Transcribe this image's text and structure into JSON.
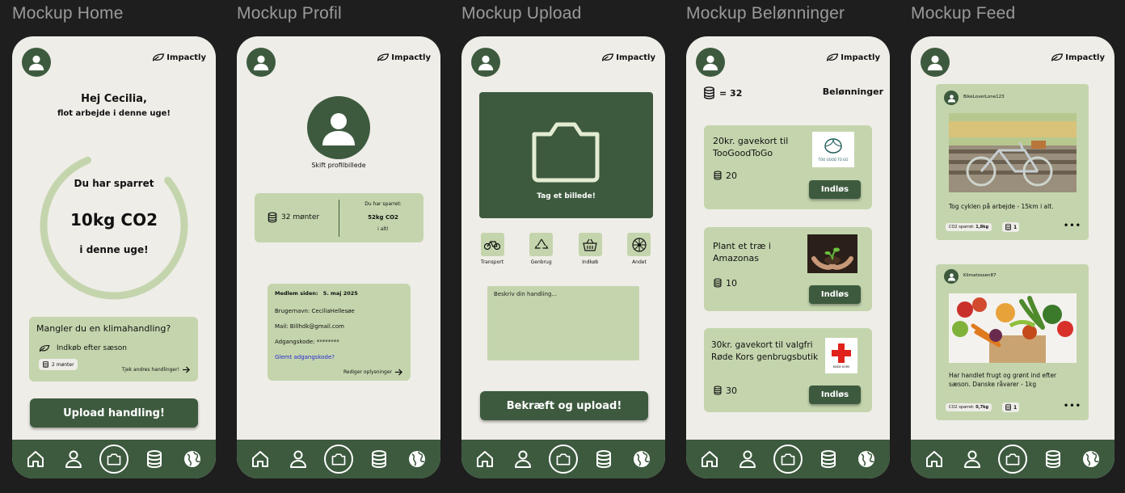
{
  "labels": {
    "home": "Mockup Home",
    "profil": "Mockup Profil",
    "upload": "Mockup Upload",
    "rewards": "Mockup Belønninger",
    "feed": "Mockup Feed"
  },
  "brand": {
    "name": "Impactly",
    "primary": "#3d5a3e",
    "card": "#c4d5ad",
    "bg": "#efede8"
  },
  "home": {
    "greeting": "Hej Cecilia,",
    "subgreeting": "flot arbejde  i denne uge!",
    "saved_label": "Du har sparret",
    "saved_value": "10kg CO2",
    "saved_period": "i denne uge!",
    "progress": 0.8,
    "missing_title": "Mangler du en klimahandling?",
    "suggestion": "Indkøb efter sæson",
    "coins": "2 mønter",
    "more_link": "Tjek andres handlinger!",
    "upload_button": "Upload handling!"
  },
  "profil": {
    "change_photo": "Skift profilbillede",
    "coins": "32 mønter",
    "saved_label": "Du har sparret:",
    "saved_value": "52kg CO2",
    "saved_total": "i alt!",
    "member_label": "Medlem siden:",
    "member_date": "5. maj 2025",
    "username": "Brugernavn: CeciliaHellesøe",
    "mail": "Mail: Billhdk@gmail.com",
    "password": "Adgangskode: ********",
    "forgot": "Glemt adgangskode?",
    "edit": "Rediger oplysninger"
  },
  "upload": {
    "camera_label": "Tag et billede!",
    "categories": [
      {
        "icon": "bike-icon",
        "label": "Transport"
      },
      {
        "icon": "recycle-icon",
        "label": "Genbrug"
      },
      {
        "icon": "basket-icon",
        "label": "Indkøb"
      },
      {
        "icon": "wheel-icon",
        "label": "Andet"
      }
    ],
    "description_placeholder": "Beskriv din handling...",
    "confirm_button": "Bekræft og upload!"
  },
  "rewards": {
    "balance": "= 32",
    "title": "Belønninger",
    "items": [
      {
        "title": "20kr. gavekort til TooGoodToGo",
        "cost": "20",
        "button": "Indløs",
        "image": "toogoodtogo-logo"
      },
      {
        "title": "Plant et træ i Amazonas",
        "cost": "10",
        "button": "Indløs",
        "image": "plant-photo"
      },
      {
        "title": "30kr. gavekort til valgfri Røde Kors genbrugsbutik",
        "cost": "30",
        "button": "Indløs",
        "image": "roede-kors-logo",
        "logo_caption": "RØDE KORS"
      }
    ],
    "tgtg_logo_text": "TOO GOOD TO GO"
  },
  "feed": {
    "posts": [
      {
        "user": "BikeLoverLone123",
        "caption": "Tog cyklen på arbejde - 15km i alt.",
        "co2_label": "CO2 sparret:",
        "co2_value": "1,8kg",
        "coins": "1",
        "image": "bike-photo"
      },
      {
        "user": "Klimatossen87",
        "caption": "Har handlet frugt og grønt ind efter sæson. Danske råvarer - 1kg",
        "co2_label": "CO2 sparret:",
        "co2_value": "0,7kg",
        "coins": "1",
        "image": "vegetables-photo"
      }
    ],
    "more": "•••"
  },
  "nav": [
    "home-icon",
    "profile-icon",
    "camera-icon",
    "coins-icon",
    "globe-icon"
  ]
}
